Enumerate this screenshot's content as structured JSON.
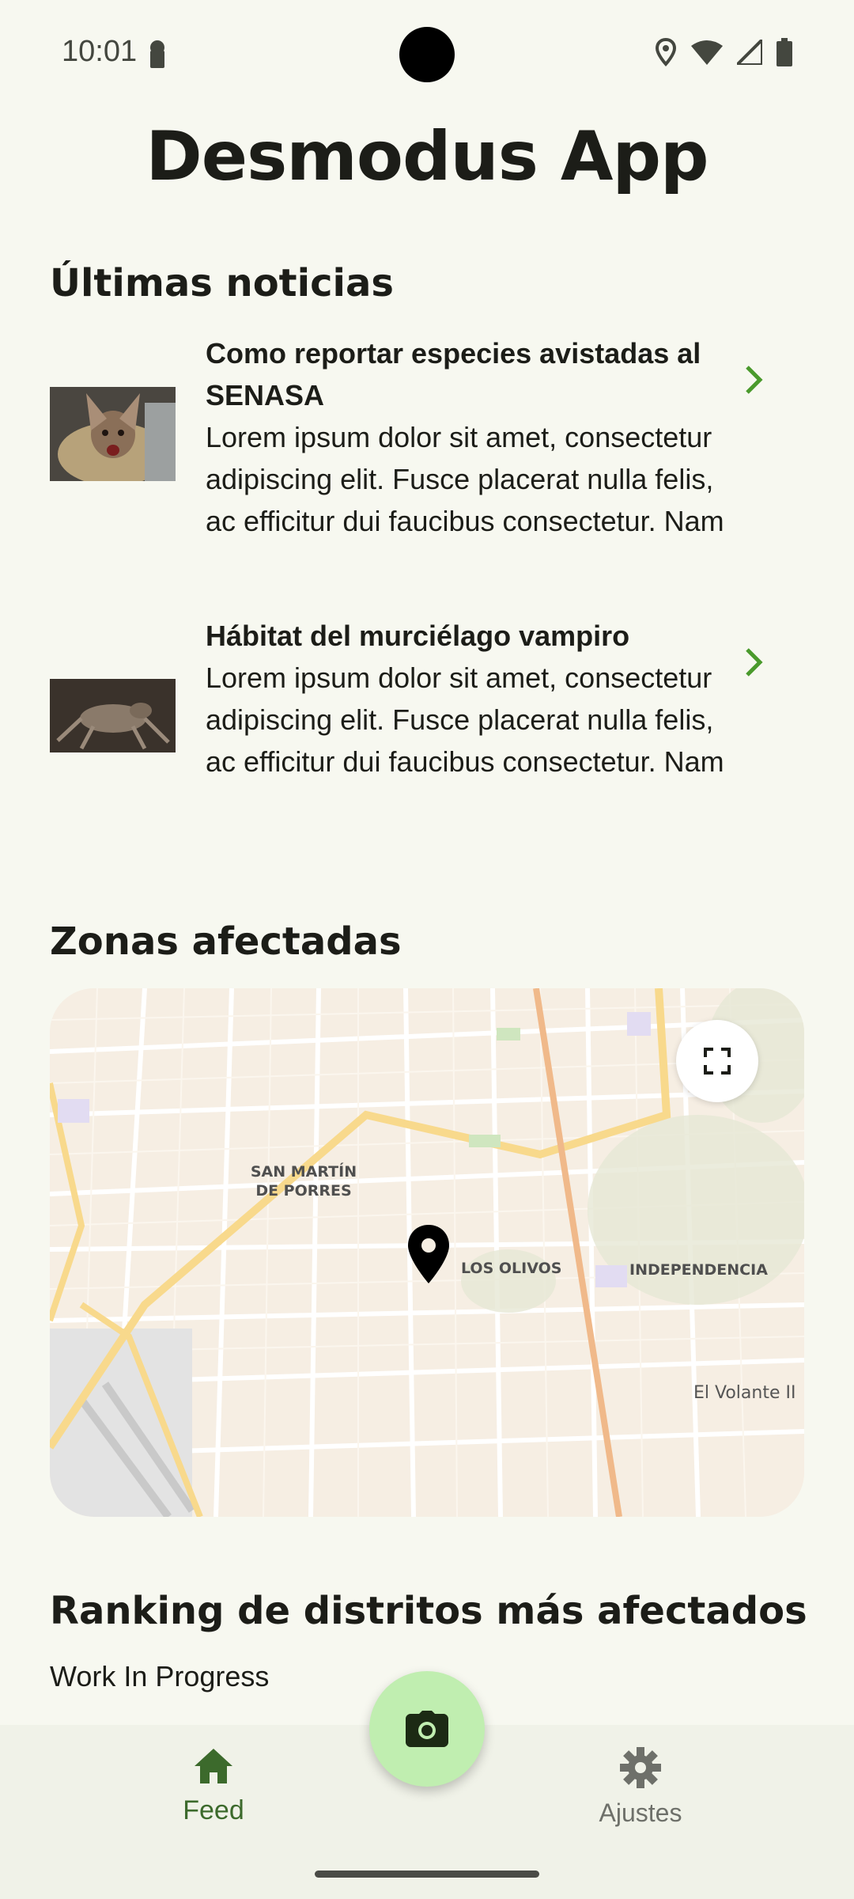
{
  "status_bar": {
    "time": "10:01"
  },
  "app": {
    "title": "Desmodus App"
  },
  "news": {
    "section_title": "Últimas noticias",
    "items": [
      {
        "title": "Como reportar especies avistadas al SENASA",
        "body": "Lorem ipsum dolor sit amet, consectetur adipiscing elit. Fusce placerat nulla felis, ac efficitur dui faucibus consectetur. Nam"
      },
      {
        "title": "Hábitat del murciélago vampiro",
        "body": "Lorem ipsum dolor sit amet, consectetur adipiscing elit. Fusce placerat nulla felis, ac efficitur dui faucibus consectetur. Nam"
      }
    ]
  },
  "zones": {
    "section_title": "Zonas afectadas",
    "map_labels": {
      "san_martin": "SAN MARTÍN\nDE PORRES",
      "los_olivos": "LOS OLIVOS",
      "independencia": "INDEPENDENCIA",
      "el_volante": "El Volante II"
    }
  },
  "ranking": {
    "section_title": "Ranking de distritos más afectados",
    "status": "Work In Progress"
  },
  "nav": {
    "feed": "Feed",
    "settings": "Ajustes"
  },
  "colors": {
    "accent_green": "#4a9a2c",
    "nav_active": "#3c6a2c",
    "fab": "#c0eeb0",
    "background": "#f7f8f0"
  }
}
